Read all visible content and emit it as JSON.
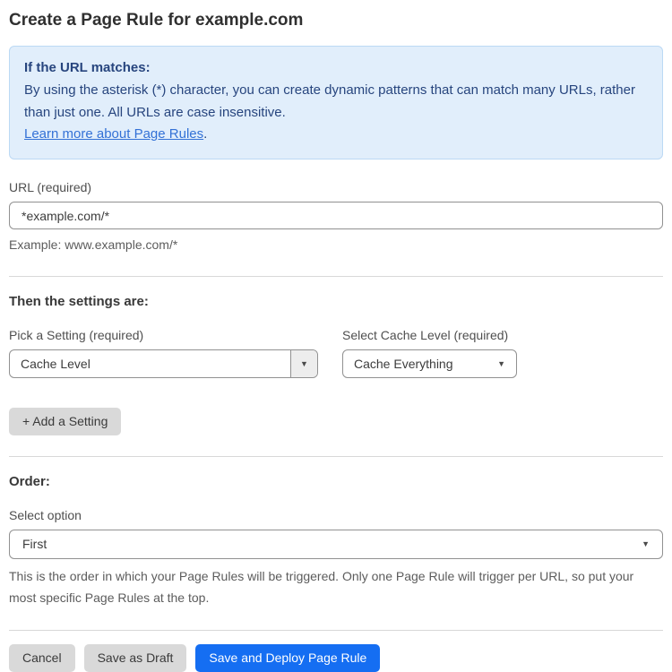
{
  "page": {
    "title": "Create a Page Rule for example.com"
  },
  "info_box": {
    "heading": "If the URL matches:",
    "body": "By using the asterisk (*) character, you can create dynamic patterns that can match many URLs, rather than just one. All URLs are case insensitive.",
    "link_label": "Learn more about Page Rules",
    "link_suffix": "."
  },
  "url_field": {
    "label": "URL (required)",
    "value": "*example.com/*",
    "helper": "Example: www.example.com/*"
  },
  "settings_section": {
    "heading": "Then the settings are:",
    "setting_picker": {
      "label": "Pick a Setting (required)",
      "value": "Cache Level"
    },
    "cache_level_picker": {
      "label": "Select Cache Level (required)",
      "value": "Cache Everything"
    },
    "add_setting_label": "+ Add a Setting"
  },
  "order_section": {
    "heading": "Order:",
    "select_label": "Select option",
    "value": "First",
    "helper": "This is the order in which your Page Rules will be triggered. Only one Page Rule will trigger per URL, so put your most specific Page Rules at the top."
  },
  "footer": {
    "cancel_label": "Cancel",
    "save_draft_label": "Save as Draft",
    "save_deploy_label": "Save and Deploy Page Rule"
  },
  "icons": {
    "dropdown_arrow": "▼"
  },
  "colors": {
    "info_bg": "#e1eefb",
    "info_border": "#bcd9f4",
    "info_text": "#27457e",
    "link": "#3371d6",
    "primary_button": "#156ef2",
    "gray_button": "#d9d9d9"
  }
}
